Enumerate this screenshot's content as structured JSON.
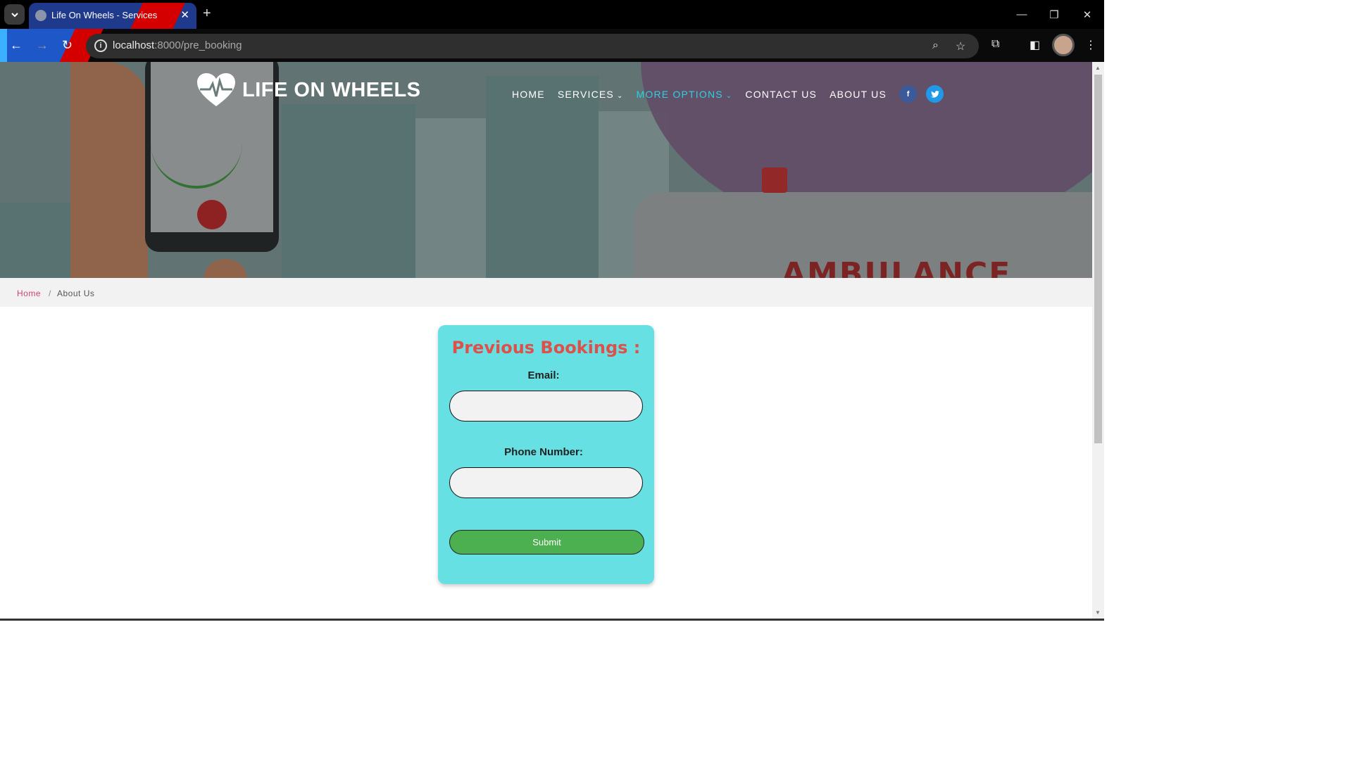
{
  "browser": {
    "tab_title": "Life On Wheels - Services",
    "url_host": "localhost",
    "url_rest": ":8000/pre_booking"
  },
  "site": {
    "logo_text": "LIFE ON WHEELS",
    "nav": {
      "home": "HOME",
      "services": "SERVICES",
      "more_options": "MORE OPTIONS",
      "contact": "CONTACT US",
      "about": "ABOUT US"
    },
    "social": {
      "facebook": "f",
      "twitter": "t"
    },
    "hero_text": "AMBULANCE"
  },
  "breadcrumb": {
    "home": "Home",
    "separator": "/",
    "current": "About Us"
  },
  "form": {
    "title": "Previous Bookings :",
    "email_label": "Email:",
    "email_value": "",
    "phone_label": "Phone Number:",
    "phone_value": "",
    "submit_label": "Submit"
  },
  "colors": {
    "accent_nav": "#2fd0e0",
    "card_bg": "#66e0e3",
    "title_red": "#e0504a",
    "submit_green": "#4caf50",
    "breadcrumb_link": "#d0406a"
  }
}
